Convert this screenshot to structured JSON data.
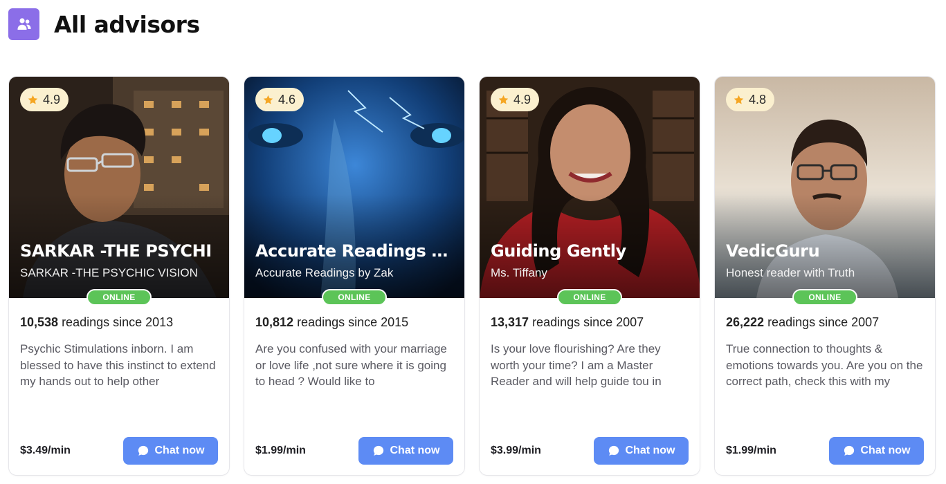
{
  "header": {
    "title": "All advisors",
    "icon": "users-icon",
    "icon_color": "#8b6ee8"
  },
  "advisors": [
    {
      "rating": "4.9",
      "name": "SARKAR -THE PSYCHI",
      "subtitle": "SARKAR -THE PSYCHIC VISION",
      "status": "ONLINE",
      "readings_count": "10,538",
      "readings_suffix": " readings since 2013",
      "description": "Psychic Stimulations inborn. I am blessed to have this instinct to extend my hands out to help other",
      "price": "$3.49/min",
      "chat_label": "Chat now"
    },
    {
      "rating": "4.6",
      "name": "Accurate Readings by…",
      "subtitle": "Accurate Readings by Zak",
      "status": "ONLINE",
      "readings_count": "10,812",
      "readings_suffix": " readings since 2015",
      "description": "Are you confused with your marriage or love life ,not sure where it is going to head ? Would like to",
      "price": "$1.99/min",
      "chat_label": "Chat now"
    },
    {
      "rating": "4.9",
      "name": "Guiding Gently",
      "subtitle": "Ms. Tiffany",
      "status": "ONLINE",
      "readings_count": "13,317",
      "readings_suffix": " readings since 2007",
      "description": "Is your love flourishing? Are they worth your time? I am a Master Reader and will help guide tou in",
      "price": "$3.99/min",
      "chat_label": "Chat now"
    },
    {
      "rating": "4.8",
      "name": "VedicGuru",
      "subtitle": "Honest reader with Truth",
      "status": "ONLINE",
      "readings_count": "26,222",
      "readings_suffix": " readings since 2007",
      "description": "True connection to thoughts & emotions towards you. Are you on the correct path, check this with my",
      "price": "$1.99/min",
      "chat_label": "Chat now"
    }
  ],
  "colors": {
    "online": "#5cc458",
    "chat_button": "#5d8bf4",
    "rating_bg": "#fbf0cf",
    "star": "#f5a623"
  }
}
